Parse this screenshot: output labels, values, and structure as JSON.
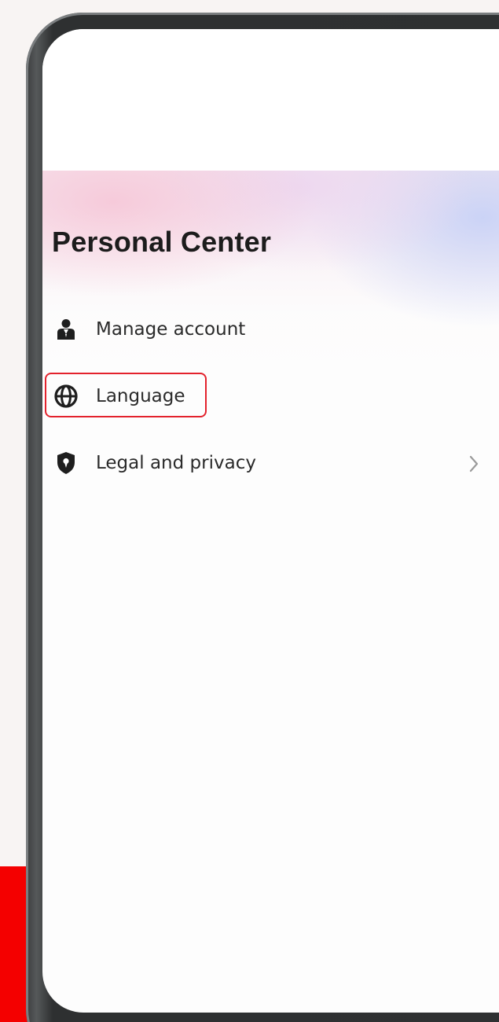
{
  "header": {
    "title": "Personal Center"
  },
  "menu": {
    "items": [
      {
        "label": "Manage account",
        "icon": "user-badge-icon"
      },
      {
        "label": "Language",
        "icon": "globe-icon"
      },
      {
        "label": "Legal and privacy",
        "icon": "shield-icon"
      }
    ]
  },
  "colors": {
    "highlight_border": "#e3222c",
    "background_band": "#f40000",
    "text": "#1c1c1c"
  }
}
